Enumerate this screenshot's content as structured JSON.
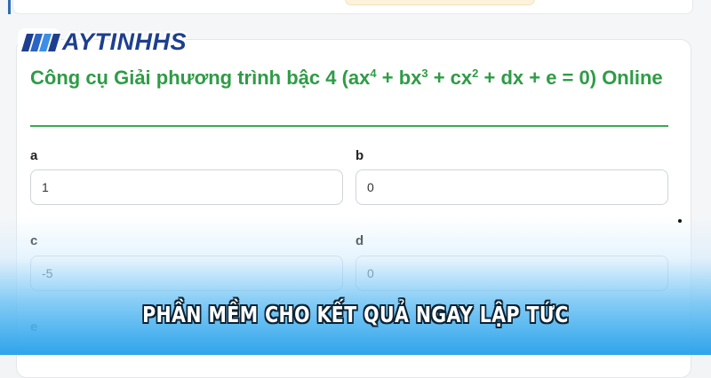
{
  "brand": {
    "logo_text": "AYTINHHS",
    "logo_color": "#1e3f8f"
  },
  "page": {
    "title_main": "Công cụ Giải phương trình bậc 4 (ax",
    "title_exp1": "4",
    "title_mid1": " + bx",
    "title_exp2": "3",
    "title_mid2": " + cx",
    "title_exp3": "2",
    "title_end": " + dx + e = 0) Online",
    "accent_color": "#2e9c46"
  },
  "form": {
    "fields": [
      {
        "label": "a",
        "value": "1"
      },
      {
        "label": "b",
        "value": "0"
      },
      {
        "label": "c",
        "value": "-5"
      },
      {
        "label": "d",
        "value": "0"
      },
      {
        "label": "e",
        "value": ""
      }
    ]
  },
  "banner": {
    "caption": "PHẦN MỀM CHO KẾT QUẢ NGAY LẬP TỨC"
  }
}
